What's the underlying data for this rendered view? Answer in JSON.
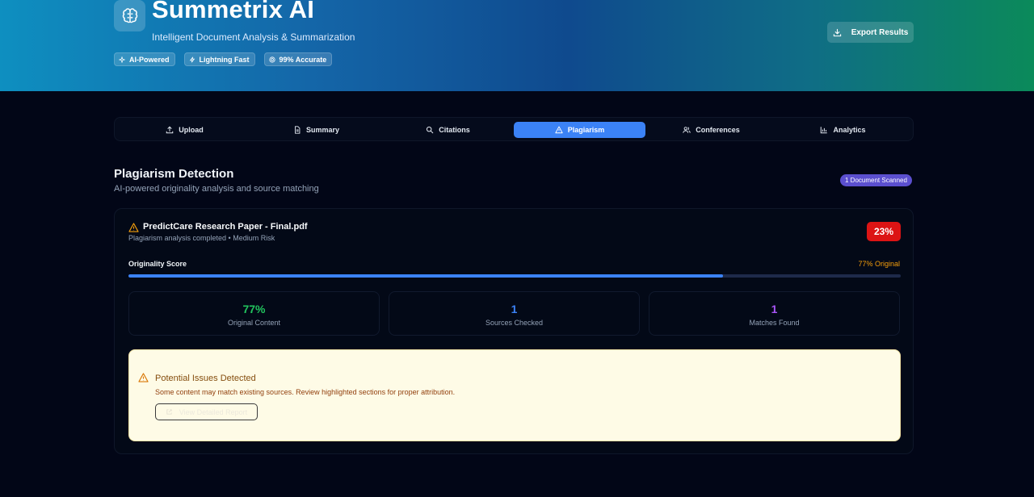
{
  "header": {
    "title": "Summetrix AI",
    "subtitle": "Intelligent Document Analysis & Summarization",
    "badges": [
      {
        "label": "AI-Powered",
        "icon": "sparkles-icon"
      },
      {
        "label": "Lightning Fast",
        "icon": "lightning-icon"
      },
      {
        "label": "99% Accurate",
        "icon": "target-icon"
      }
    ],
    "export_label": "Export Results"
  },
  "tabs": [
    {
      "label": "Upload",
      "icon": "upload-icon",
      "active": false
    },
    {
      "label": "Summary",
      "icon": "document-icon",
      "active": false
    },
    {
      "label": "Citations",
      "icon": "search-icon",
      "active": false
    },
    {
      "label": "Plagiarism",
      "icon": "warning-icon",
      "active": true
    },
    {
      "label": "Conferences",
      "icon": "users-icon",
      "active": false
    },
    {
      "label": "Analytics",
      "icon": "bar-chart-icon",
      "active": false
    }
  ],
  "section": {
    "title": "Plagiarism Detection",
    "subtitle": "AI-powered originality analysis and source matching",
    "scan_badge": "1 Document Scanned"
  },
  "document": {
    "title": "PredictCare Research Paper - Final.pdf",
    "status": "Plagiarism analysis completed • Medium Risk",
    "similarity": "23%",
    "score_label": "Originality Score",
    "score_value": "77% Original",
    "originality_fraction": 0.77
  },
  "stats": [
    {
      "value": "77%",
      "label": "Original Content",
      "color": "#22c55e"
    },
    {
      "value": "1",
      "label": "Sources Checked",
      "color": "#3b82f6"
    },
    {
      "value": "1",
      "label": "Matches Found",
      "color": "#a855f7"
    }
  ],
  "alert": {
    "title": "Potential Issues Detected",
    "text": "Some content may match existing sources. Review highlighted sections for proper attribution.",
    "button_label": "View Detailed Report"
  },
  "colors": {
    "accent": "#3b82f6",
    "danger": "#dc1414",
    "warning": "#f59e0b"
  }
}
